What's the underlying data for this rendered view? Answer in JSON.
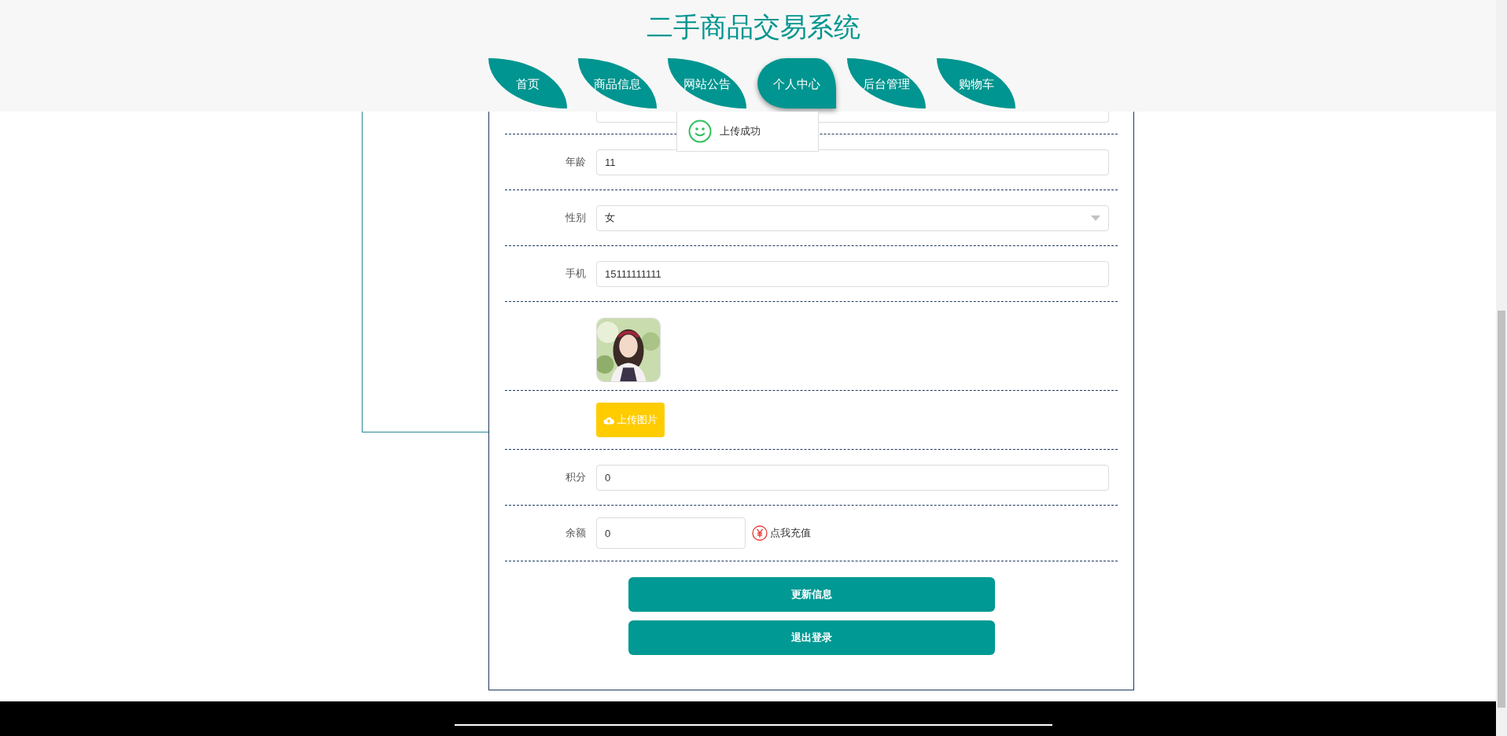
{
  "header": {
    "title": "二手商品交易系统",
    "nav": [
      {
        "label": "首页",
        "selected": false
      },
      {
        "label": "商品信息",
        "selected": false
      },
      {
        "label": "网站公告",
        "selected": false
      },
      {
        "label": "个人中心",
        "selected": true
      },
      {
        "label": "后台管理",
        "selected": false
      },
      {
        "label": "购物车",
        "selected": false
      }
    ]
  },
  "toast": {
    "message": "上传成功"
  },
  "form": {
    "rows": [
      {
        "kind": "partial"
      },
      {
        "kind": "input",
        "label": "年龄",
        "value": "11"
      },
      {
        "kind": "select",
        "label": "性别",
        "value": "女"
      },
      {
        "kind": "input",
        "label": "手机",
        "value": "15111111111"
      },
      {
        "kind": "avatar"
      },
      {
        "kind": "upload",
        "button": "上传图片"
      },
      {
        "kind": "input",
        "label": "积分",
        "value": "0"
      },
      {
        "kind": "balance",
        "label": "余额",
        "value": "0",
        "link": "点我充值"
      }
    ],
    "buttons": [
      "更新信息",
      "退出登录"
    ]
  }
}
